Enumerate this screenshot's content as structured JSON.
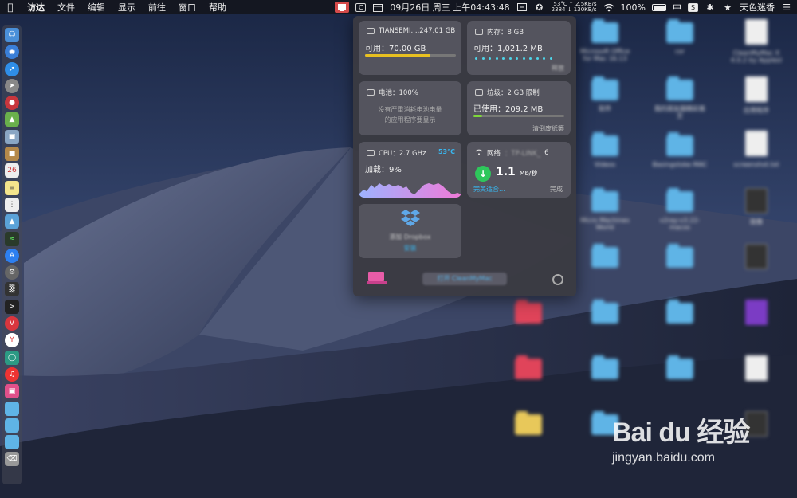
{
  "menubar": {
    "app_name": "访达",
    "menus": [
      "文件",
      "编辑",
      "显示",
      "前往",
      "窗口",
      "帮助"
    ],
    "cpu_temp_line": "53°C ↑ 2.5KB/s",
    "net_line": "2384 ↓ 130KB/s",
    "date": "09月26日 周三 上午04:43:48",
    "battery_percent": "100%",
    "input_method": "中",
    "user_name": "天色迷香"
  },
  "panel": {
    "disk": {
      "name": "TIANSEMI....247.01 GB",
      "available": "可用：70.00 GB",
      "used_fraction": 0.72,
      "color": "#e8c020"
    },
    "memory": {
      "title": "内存：8 GB",
      "available": "可用：1,021.2 MB",
      "action": "释放"
    },
    "battery": {
      "title": "电池：100%",
      "message_line1": "没有严重消耗电池电量",
      "message_line2": "的应用程序要显示"
    },
    "trash": {
      "title": "垃圾：2 GB 限制",
      "used": "已使用：209.2 MB",
      "action": "清倒废纸篓",
      "used_fraction": 0.1,
      "color": "#7ed83a"
    },
    "cpu": {
      "title": "CPU：2.7 GHz",
      "temp": "53°C",
      "load": "加载：9%"
    },
    "network": {
      "title": "网络",
      "ssid_tail": "6",
      "speed": "1.1",
      "unit": "Mb/秒",
      "status": "完美适合…",
      "done": "完成"
    },
    "dropbox": {
      "label": "添加 Dropbox",
      "link": "安装"
    },
    "open_button": "打开 CleanMyMac"
  },
  "desktop": {
    "icons": [
      {
        "label": "Microsoft Office for Mac 16.13"
      },
      {
        "label": "csr"
      },
      {
        "label": "CleanMyMac X 4.0.2 by Applesl"
      },
      {
        "label": "软件"
      },
      {
        "label": "我的朋友圈精彩推文"
      },
      {
        "label": "应用程序"
      },
      {
        "label": "Videos"
      },
      {
        "label": "Basingstoke MAC"
      },
      {
        "label": "screenshot.txt"
      },
      {
        "label": "Micro Machines World"
      },
      {
        "label": "v2ray-v3.22-macos"
      },
      {
        "label": "图像"
      }
    ]
  },
  "watermark": {
    "brand": "Bai du 经验",
    "url": "jingyan.baidu.com"
  }
}
